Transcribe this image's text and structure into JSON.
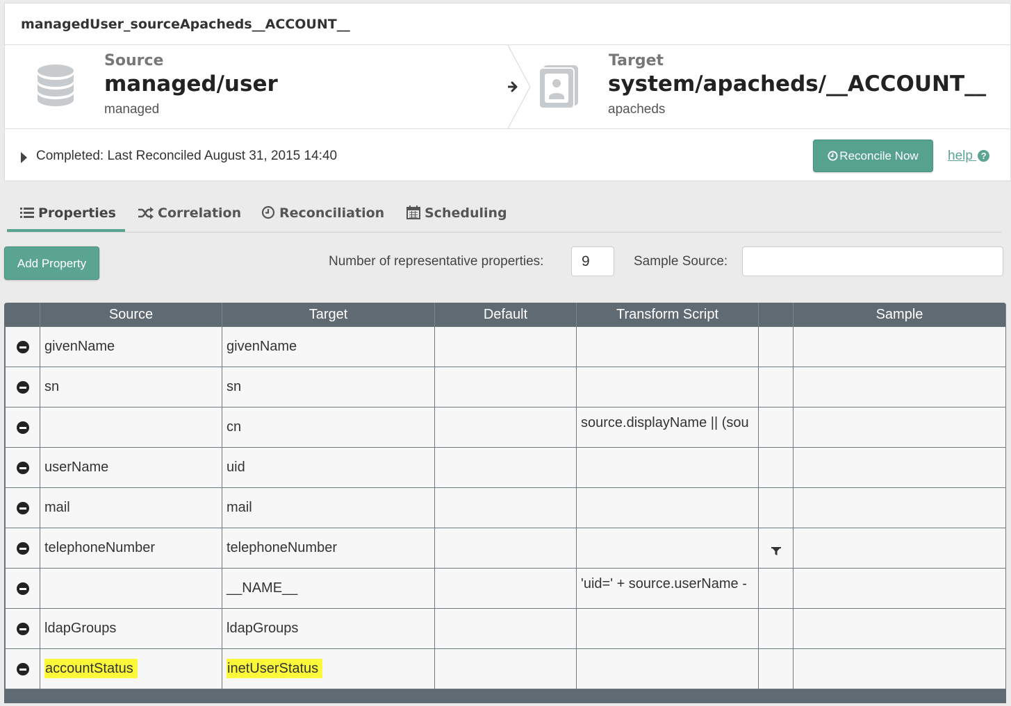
{
  "header": {
    "title": "managedUser_sourceApacheds__ACCOUNT__"
  },
  "mapping": {
    "source": {
      "label": "Source",
      "name": "managed/user",
      "type": "managed"
    },
    "target": {
      "label": "Target",
      "name": "system/apacheds/__ACCOUNT__",
      "type": "apacheds"
    }
  },
  "status": {
    "text": "Completed: Last Reconciled August 31, 2015 14:40",
    "reconcile_button": "Reconcile Now",
    "help_link": "help"
  },
  "tabs": [
    {
      "label": "Properties",
      "icon": "list-icon",
      "active": true
    },
    {
      "label": "Correlation",
      "icon": "shuffle-icon",
      "active": false
    },
    {
      "label": "Reconciliation",
      "icon": "clock-icon",
      "active": false
    },
    {
      "label": "Scheduling",
      "icon": "calendar-icon",
      "active": false
    }
  ],
  "toolbar": {
    "add_property": "Add Property",
    "num_label": "Number of representative properties:",
    "num_value": "9",
    "sample_label": "Sample Source:",
    "sample_value": ""
  },
  "table": {
    "columns": [
      "Source",
      "Target",
      "Default",
      "Transform Script",
      "Sample"
    ],
    "rows": [
      {
        "source": "givenName",
        "target": "givenName",
        "default": "",
        "script": "",
        "filter": false,
        "highlight": false
      },
      {
        "source": "sn",
        "target": "sn",
        "default": "",
        "script": "",
        "filter": false,
        "highlight": false
      },
      {
        "source": "",
        "target": "cn",
        "default": "",
        "script": "source.displayName || (sou",
        "filter": false,
        "highlight": false
      },
      {
        "source": "userName",
        "target": "uid",
        "default": "",
        "script": "",
        "filter": false,
        "highlight": false
      },
      {
        "source": "mail",
        "target": "mail",
        "default": "",
        "script": "",
        "filter": false,
        "highlight": false
      },
      {
        "source": "telephoneNumber",
        "target": "telephoneNumber",
        "default": "",
        "script": "",
        "filter": true,
        "highlight": false
      },
      {
        "source": "",
        "target": "__NAME__",
        "default": "",
        "script": "'uid=' +  source.userName -",
        "filter": false,
        "highlight": false
      },
      {
        "source": "ldapGroups",
        "target": "ldapGroups",
        "default": "",
        "script": "",
        "filter": false,
        "highlight": false
      },
      {
        "source": "accountStatus",
        "target": "inetUserStatus",
        "default": "",
        "script": "",
        "filter": false,
        "highlight": true
      }
    ]
  },
  "colors": {
    "accent": "#5ba492",
    "header_bg": "#5f6a72",
    "highlight": "#fbf93a"
  }
}
